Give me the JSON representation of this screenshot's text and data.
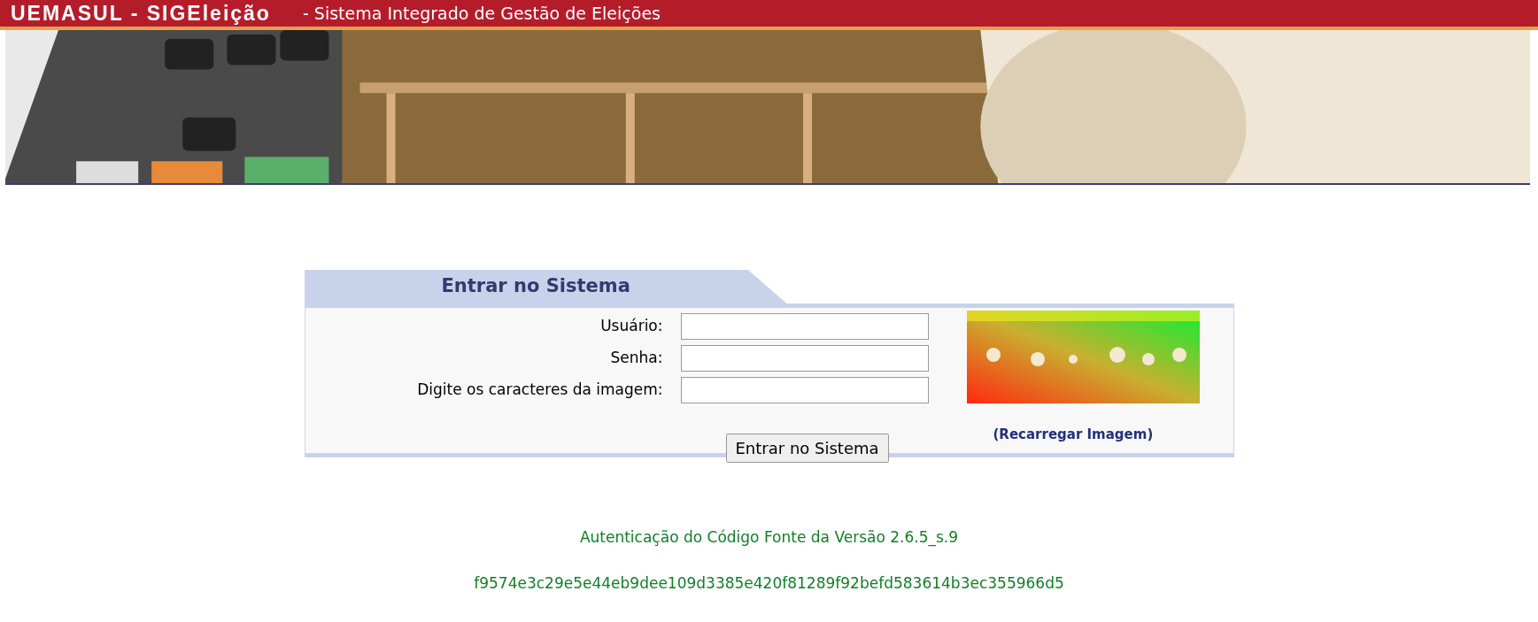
{
  "header": {
    "title": "UEMASUL - SIGEleição",
    "subtitle": "- Sistema Integrado de Gestão de Eleições"
  },
  "login": {
    "title": "Entrar no Sistema",
    "fields": [
      {
        "label": "Usuário:"
      },
      {
        "label": "Senha:"
      },
      {
        "label": "Digite os caracteres da imagem:"
      }
    ],
    "reload_link": "(Recarregar Imagem)",
    "submit": "Entrar no Sistema"
  },
  "footer": {
    "version": "Autenticação do Código Fonte da Versão 2.6.5_s.9",
    "hash": "f9574e3c29e5e44eb9dee109d3385e420f81289f92befd583614b3ec355966d5"
  }
}
